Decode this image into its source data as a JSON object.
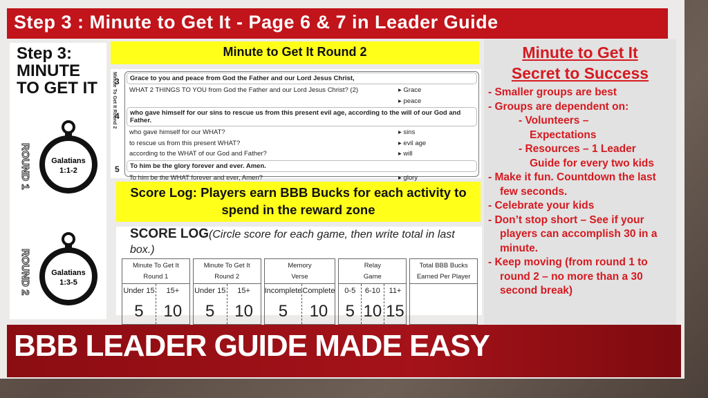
{
  "title": "Step 3 :  Minute to Get It - Page 6 & 7 in Leader Guide",
  "left_image": {
    "heading": [
      "Step 3:",
      "MINUTE",
      "TO GET IT"
    ],
    "rounds": [
      {
        "label": "ROUND 1",
        "verse": [
          "Galatians",
          "1:1-2"
        ]
      },
      {
        "label": "ROUND 2",
        "verse": [
          "Galatians",
          "1:3-5"
        ]
      }
    ]
  },
  "round2_label": "Minute to Get It Round 2",
  "verses": {
    "side_label": "Minute To Get It Round 2",
    "items": [
      {
        "num": "3",
        "text": "Grace to you and peace from God the Father and our Lord Jesus Christ,",
        "questions": [
          {
            "q": "WHAT 2 THINGS TO YOU from God the Father and our Lord Jesus Christ? (2)",
            "a": "Grace"
          },
          {
            "q": "",
            "a": "peace"
          }
        ]
      },
      {
        "num": "4",
        "text": "who gave himself for our sins to rescue us from this present evil age, according to the will of our God and Father.",
        "questions": [
          {
            "q": "who gave himself for our WHAT?",
            "a": "sins"
          },
          {
            "q": "to rescue us from this present WHAT?",
            "a": "evil age"
          },
          {
            "q": "according to the WHAT of our God and Father?",
            "a": "will"
          }
        ]
      },
      {
        "num": "5",
        "text": "To him be the glory forever and ever. Amen.",
        "questions": [
          {
            "q": "To him be the WHAT forever and ever, Amen?",
            "a": "glory"
          }
        ]
      }
    ]
  },
  "score_caption": "Score Log: Players earn BBB Bucks for each activity to spend in the reward zone",
  "score_log": {
    "title": "SCORE LOG",
    "subtitle": "(Circle score for each game, then write total in last box.)",
    "columns": [
      {
        "l1": "Minute To Get It",
        "l2": "Round 1",
        "options": [
          {
            "label": "Under 15",
            "score": "5"
          },
          {
            "label": "15+",
            "score": "10"
          }
        ]
      },
      {
        "l1": "Minute To Get It",
        "l2": "Round 2",
        "options": [
          {
            "label": "Under 15",
            "score": "5"
          },
          {
            "label": "15+",
            "score": "10"
          }
        ]
      },
      {
        "l1": "Memory",
        "l2": "Verse",
        "options": [
          {
            "label": "Incomplete",
            "score": "5"
          },
          {
            "label": "Complete",
            "score": "10"
          }
        ]
      },
      {
        "l1": "Relay",
        "l2": "Game",
        "options": [
          {
            "label": "0-5",
            "score": "5"
          },
          {
            "label": "6-10",
            "score": "10"
          },
          {
            "label": "11+",
            "score": "15"
          }
        ]
      },
      {
        "l1": "Total BBB Bucks",
        "l2": "Earned Per Player",
        "options": []
      }
    ]
  },
  "tips": {
    "heading1": "Minute to Get It",
    "heading2": "Secret to Success",
    "items": [
      {
        "type": "main",
        "text": "-  Smaller groups are best"
      },
      {
        "type": "main",
        "text": "-  Groups are dependent on:"
      },
      {
        "type": "sub",
        "text": "-  Volunteers –"
      },
      {
        "type": "cont",
        "text": "Expectations"
      },
      {
        "type": "sub",
        "text": "-  Resources – 1 Leader"
      },
      {
        "type": "cont",
        "text": "Guide for every two kids"
      },
      {
        "type": "main",
        "text": "-  Make it fun.  Countdown the last few seconds."
      },
      {
        "type": "main",
        "text": "-  Celebrate your kids"
      },
      {
        "type": "main",
        "text": "-  Don’t stop short – See if your players can accomplish 30 in a minute."
      },
      {
        "type": "main",
        "text": "-  Keep moving (from round 1 to round  2 – no more than a 30 second break)"
      }
    ]
  },
  "banner": "BBB LEADER GUIDE MADE EASY"
}
